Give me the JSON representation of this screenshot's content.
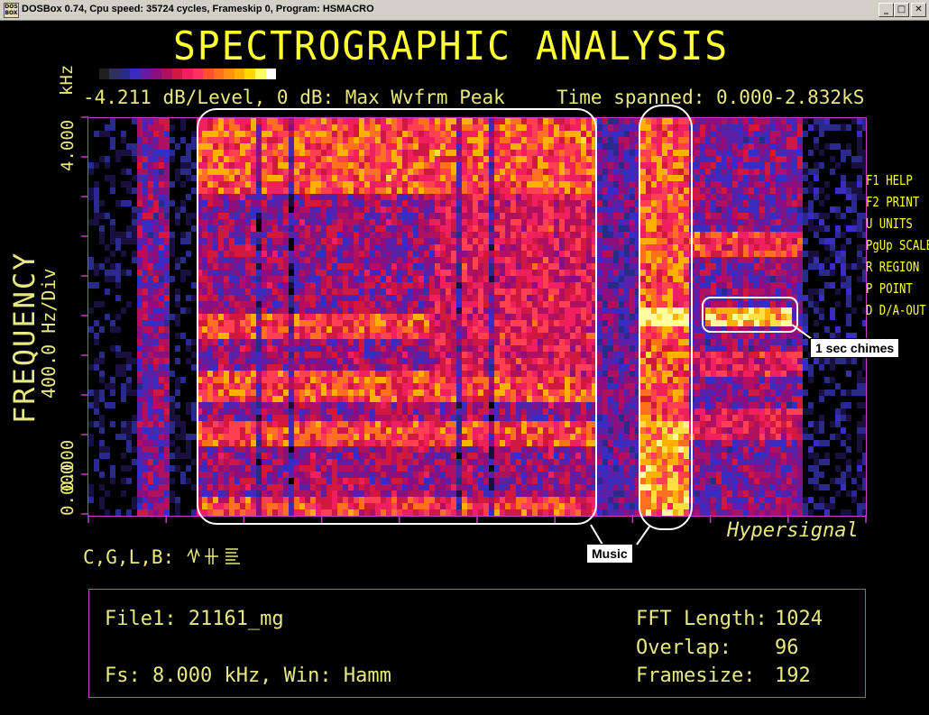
{
  "window": {
    "title": "DOSBox 0.74, Cpu speed:    35724 cycles, Frameskip  0, Program:  HSMACRO",
    "icon_text": "DOS BOX",
    "buttons": [
      "minimize-icon",
      "maximize-icon",
      "close-icon"
    ]
  },
  "screen": {
    "title": "SPECTROGRAPHIC ANALYSIS",
    "level_info": "-4.211 dB/Level, 0 dB: Max Wvfrm Peak",
    "time_spanned": "Time spanned: 0.000-2.832kS",
    "freq_axis": {
      "label": "FREQUENCY",
      "per_div": "400.0 Hz/Div",
      "unit": "kHz",
      "top_tick": "4.000",
      "bottom_tick_1": "0.000",
      "bottom_tick_2": "0.000"
    },
    "brand": "Hypersignal",
    "command_prefix": "C,G,L,B:",
    "menu": [
      "F1 HELP",
      "F2 PRINT",
      "U UNITS",
      "PgUp SCALE",
      "R REGION",
      "P POINT",
      "D D/A-OUT"
    ]
  },
  "info_box": {
    "file": "File1: 21161_mg",
    "fs": "Fs: 8.000 kHz, Win: Hamm",
    "fft_label": "FFT Length:",
    "fft_value": "1024",
    "overlap_label": "Overlap:",
    "overlap_value": "96",
    "framesize_label": "Framesize:",
    "framesize_value": "192"
  },
  "annotations": {
    "music": "Music",
    "chimes": "1 sec chimes"
  },
  "colors": {
    "accent_yellow": "#ffff33",
    "plot_border": "#c040c0",
    "scale": [
      "#000000",
      "#202020",
      "#303060",
      "#2a2a8a",
      "#3a2cc0",
      "#6a1aa0",
      "#8a1080",
      "#b01060",
      "#d01840",
      "#f02060",
      "#ff3060",
      "#ff5030",
      "#ff7020",
      "#ff9010",
      "#ffb000",
      "#ffd800",
      "#ffff60",
      "#ffffff"
    ]
  }
}
